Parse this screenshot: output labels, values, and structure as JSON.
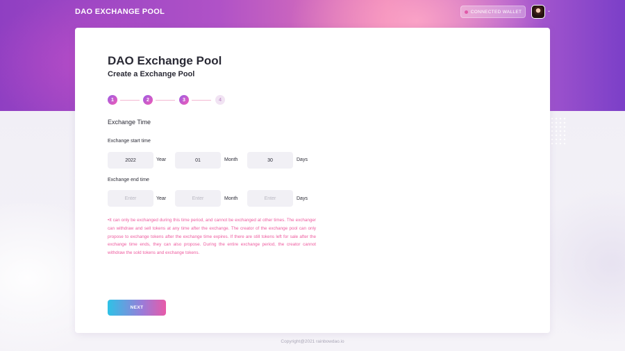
{
  "header": {
    "brand": "DAO EXCHANGE POOL",
    "wallet_label": "CONNECTED  WALLET",
    "chevron": "⌄"
  },
  "card": {
    "title": "DAO Exchange Pool",
    "subtitle": "Create a Exchange Pool",
    "steps": [
      {
        "number": "1",
        "state": "done"
      },
      {
        "number": "2",
        "state": "done"
      },
      {
        "number": "3",
        "state": "active"
      },
      {
        "number": "4",
        "state": "pending"
      }
    ],
    "section_title": "Exchange Time",
    "start": {
      "label": "Exchange start time",
      "year": "2022",
      "month": "01",
      "day": "30"
    },
    "end": {
      "label": "Exchange end time",
      "year": "",
      "month": "",
      "day": "",
      "placeholder": "Enter"
    },
    "units": {
      "year": "Year",
      "month": "Month",
      "day": "Days"
    },
    "notice": "•It can only be exchanged during this time period, and cannot be exchanged at other times. The exchanger can withdraw and sell tokens at any time after the exchange. The creator of the exchange pool can only propose to exchange tokens after the exchange time expires. If there are still tokens left for sale after the exchange time ends, they can also propose. During the entire exchange period, the creator cannot withdraw the sold tokens and exchange tokens.",
    "next_label": "NEXT"
  },
  "footer": {
    "copyright": "Copyright@2021 rainbowdao.io"
  },
  "colors": {
    "accent_pink": "#ee5a9e",
    "accent_purple": "#9b5de5",
    "button_gradient_start": "#2ec2e6",
    "button_gradient_end": "#e85aa8"
  }
}
